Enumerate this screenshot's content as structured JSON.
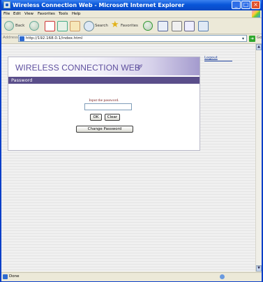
{
  "window": {
    "title": "Wireless Connection Web - Microsoft Internet Explorer",
    "min_label": "_",
    "max_label": "□",
    "close_label": "×"
  },
  "menu": [
    "File",
    "Edit",
    "View",
    "Favorites",
    "Tools",
    "Help"
  ],
  "toolbar": {
    "back_label": "Back",
    "search_label": "Search",
    "favorites_label": "Favorites"
  },
  "address": {
    "label": "Address",
    "url": "http://192.168.0.1/index.html",
    "go_label": "Go"
  },
  "page": {
    "banner_title": "WIRELESS CONNECTION WEB",
    "banner_icon": "✐",
    "logout": "Logout",
    "section_title": "Password",
    "prompt": "Input the password.",
    "password_value": "",
    "ok_label": "OK",
    "clear_label": "Clear",
    "change_label": "Change Password"
  },
  "status": {
    "text": "Done"
  },
  "colors": {
    "titlebar": "#0a48c4",
    "banner_text": "#5e4f9e",
    "section_bar": "#5a4e8a",
    "prompt_text": "#7a1f1f"
  }
}
